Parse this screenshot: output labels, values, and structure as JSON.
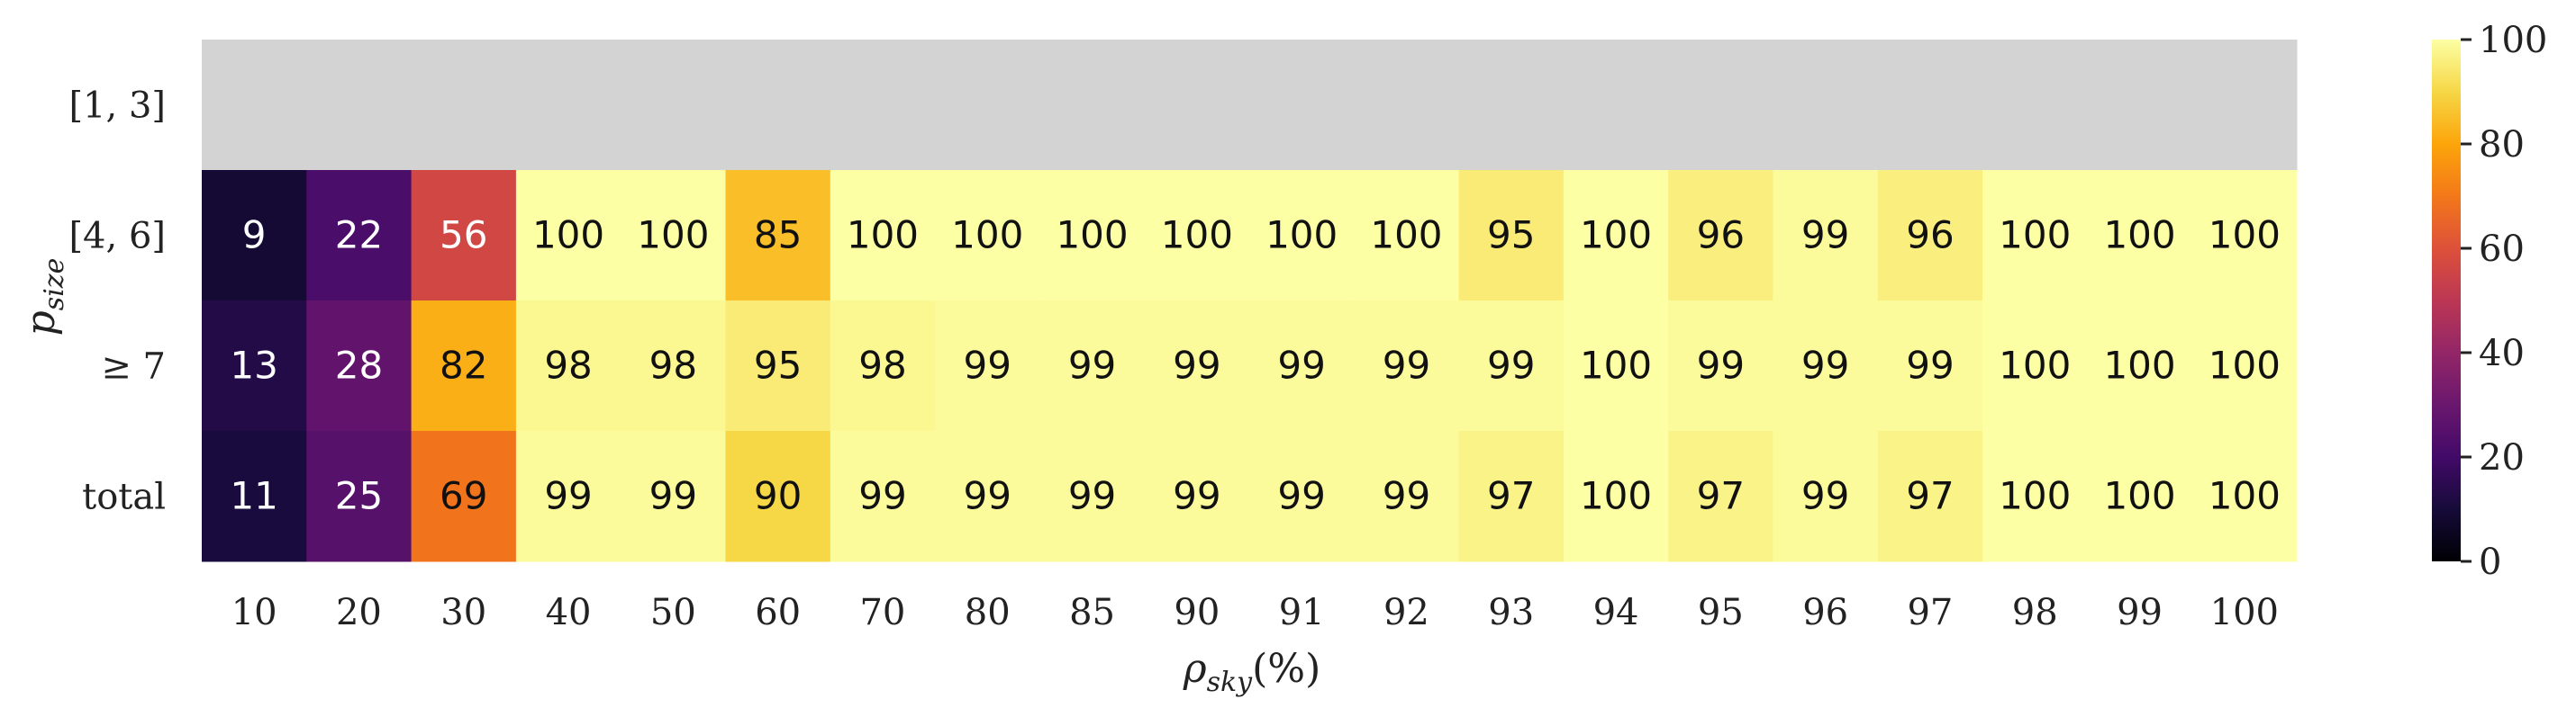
{
  "chart_data": {
    "type": "heatmap",
    "x_categories": [
      "10",
      "20",
      "30",
      "40",
      "50",
      "60",
      "70",
      "80",
      "85",
      "90",
      "91",
      "92",
      "93",
      "94",
      "95",
      "96",
      "97",
      "98",
      "99",
      "100"
    ],
    "y_categories": [
      "[1, 3]",
      "[4, 6]",
      "≥ 7",
      "total"
    ],
    "values": [
      [
        null,
        null,
        null,
        null,
        null,
        null,
        null,
        null,
        null,
        null,
        null,
        null,
        null,
        null,
        null,
        null,
        null,
        null,
        null,
        null
      ],
      [
        9,
        22,
        56,
        100,
        100,
        85,
        100,
        100,
        100,
        100,
        100,
        100,
        95,
        100,
        96,
        99,
        96,
        100,
        100,
        100
      ],
      [
        13,
        28,
        82,
        98,
        98,
        95,
        98,
        99,
        99,
        99,
        99,
        99,
        99,
        100,
        99,
        99,
        99,
        100,
        100,
        100
      ],
      [
        11,
        25,
        69,
        99,
        99,
        90,
        99,
        99,
        99,
        99,
        99,
        99,
        97,
        100,
        97,
        99,
        97,
        100,
        100,
        100
      ]
    ],
    "xlabel_main": "ρ",
    "xlabel_sub": "sky",
    "xlabel_suffix": "(%)",
    "ylabel_main": "p",
    "ylabel_sub": "size",
    "colorbar": {
      "colormap": "inferno",
      "range": [
        0,
        100
      ],
      "ticks": [
        "0",
        "20",
        "40",
        "60",
        "80",
        "100"
      ]
    },
    "missing_color": "#d3d3d3"
  }
}
